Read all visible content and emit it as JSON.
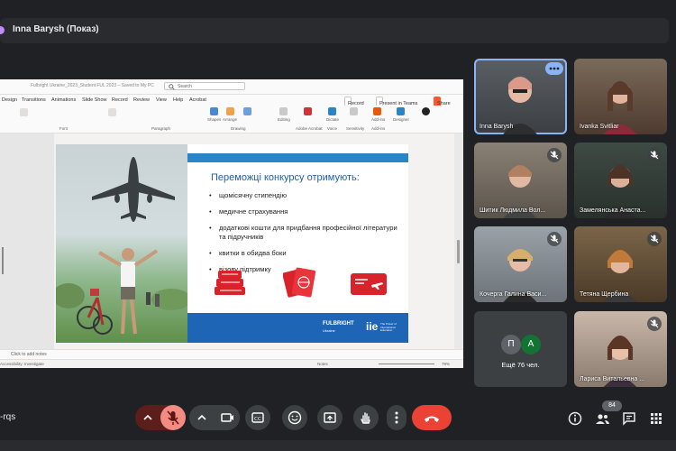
{
  "presenter_bar": {
    "label": "Inna Barysh (Показ)"
  },
  "powerpoint": {
    "doc_title": "Fulbright Ukraine_2023_Student FUL 2023 – Saved to My PC",
    "search_placeholder": "Search",
    "menu": [
      "Design",
      "Transitions",
      "Animations",
      "Slide Show",
      "Record",
      "Review",
      "View",
      "Help",
      "Acrobat"
    ],
    "buttons": {
      "record": "Record",
      "present_teams": "Present in Teams",
      "share": "Share"
    },
    "ribbon_labels": [
      "Font",
      "Paragraph",
      "Drawing",
      "Adobe Acrobat",
      "Voice",
      "Sensitivity",
      "Add-ins"
    ],
    "ribbon_items": [
      "Shapes",
      "Arrange",
      "Quick Styles",
      "Editing",
      "Create PDF and Share link",
      "Dictate",
      "Sensitivity",
      "Add-ins",
      "Designer",
      "Read on reMarkable"
    ],
    "notes_placeholder": "Click to add notes",
    "status_left": "Accessibility: Investigate",
    "status_notes": "Notes",
    "zoom": "79%"
  },
  "slide": {
    "heading": "Переможці конкурсу отримують:",
    "bullets": [
      "щомісячну стипендію",
      "медичне страхування",
      "додаткові кошти для придбання професійної літератури та підручників",
      "квитки в обидва боки",
      "візову підтримку"
    ],
    "footer": {
      "fulbright": "FULBRIGHT",
      "fulbright_sub": "Ukraine",
      "iie": "iie",
      "iie_sub": "The Power of International Education"
    }
  },
  "participants": [
    {
      "name": "Inna Barysh",
      "muted": false,
      "active": true
    },
    {
      "name": "Ivanka Svitliar",
      "muted": false,
      "active": false
    },
    {
      "name": "Шитик Людмила Вол...",
      "muted": true,
      "active": false
    },
    {
      "name": "Замелянська Анаста...",
      "muted": true,
      "active": false
    },
    {
      "name": "Кочерга Галина Васи...",
      "muted": true,
      "active": false
    },
    {
      "name": "Тетяна Щербина",
      "muted": true,
      "active": false
    },
    {
      "name": "Лариса Витальевна ...",
      "muted": true,
      "active": false
    }
  ],
  "more_participants": {
    "avatars": [
      "П",
      "А"
    ],
    "label": "Ещё 76 чел."
  },
  "controls": {
    "meeting_code": "-rqs",
    "participant_count": "84"
  },
  "colors": {
    "accent_blue": "#8ab4f8",
    "end_call": "#ea4335",
    "slide_blue": "#1e65b5"
  }
}
